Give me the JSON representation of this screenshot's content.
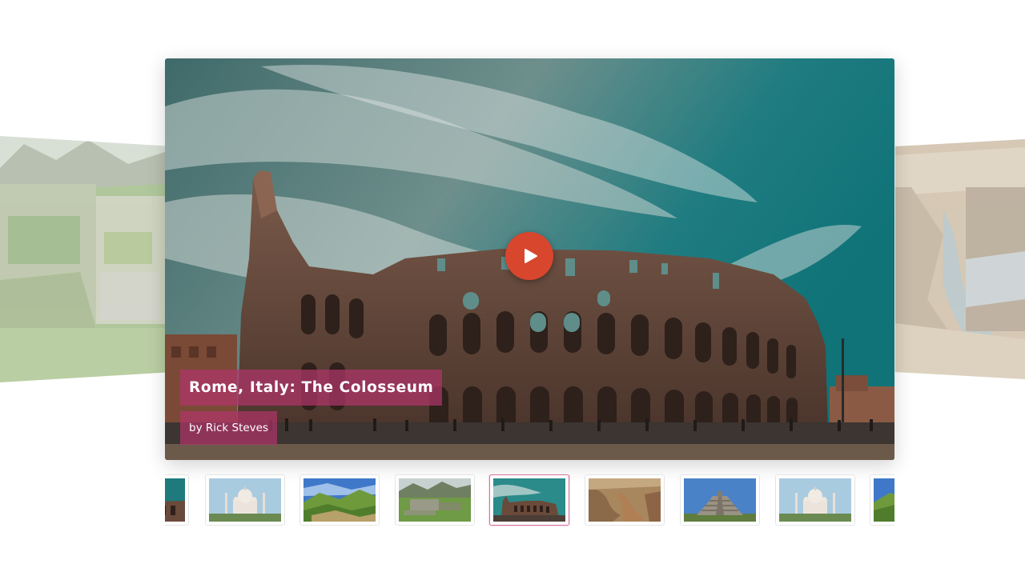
{
  "slide": {
    "title": "Rome, Italy: The Colosseum",
    "author": "by Rick Steves"
  },
  "side_slides": {
    "left": "machu-picchu-ruins",
    "right": "canyon-landscape"
  },
  "thumbnails": [
    {
      "image": "colosseum-partial",
      "active": false
    },
    {
      "image": "taj-mahal",
      "active": false
    },
    {
      "image": "green-mountains",
      "active": false
    },
    {
      "image": "machu-picchu",
      "active": false
    },
    {
      "image": "colosseum",
      "active": true
    },
    {
      "image": "canyon",
      "active": false
    },
    {
      "image": "chichen-itza-pyramid",
      "active": false
    },
    {
      "image": "taj-mahal",
      "active": false
    },
    {
      "image": "green-mountains-partial",
      "active": false
    }
  ],
  "colors": {
    "caption_bg": "#b0346a",
    "play_button": "#d9462e",
    "active_thumb_border": "#d9729f"
  }
}
